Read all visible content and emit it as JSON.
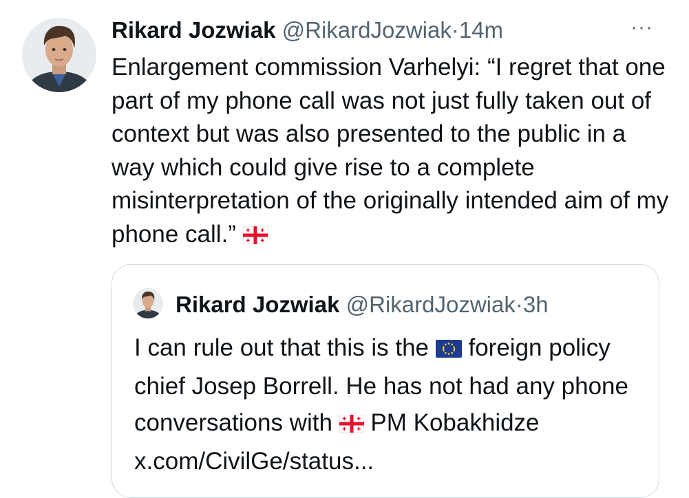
{
  "tweet": {
    "author_name": "Rikard Jozwiak",
    "author_handle": "@RikardJozwiak",
    "separator": "·",
    "time": "14m",
    "more_label": "···",
    "text": "Enlargement commission Varhelyi: “I regret that one part of my phone call was not just fully taken out of context but was also presented to the public in a way which could give rise to a complete misinterpretation of the originally intended aim of my phone call.”",
    "flag_icon": "georgia-flag-icon"
  },
  "quote": {
    "author_name": "Rikard Jozwiak",
    "author_handle": "@RikardJozwiak",
    "separator": "·",
    "time": "3h",
    "text_part1": "I can rule out that this is the",
    "text_part2": "foreign policy chief Josep Borrell. He has not had any phone conversations with",
    "text_part3": "PM Kobakhidze x.com/CivilGe/status...",
    "eu_flag_icon": "eu-flag-icon",
    "georgia_flag_icon": "georgia-flag-icon"
  },
  "colors": {
    "text": "#0f1419",
    "secondary": "#536471",
    "border": "#cfd9de",
    "eu_blue": "#1f3a93",
    "eu_star": "#f5d90a",
    "georgia_red": "#e8112d"
  }
}
